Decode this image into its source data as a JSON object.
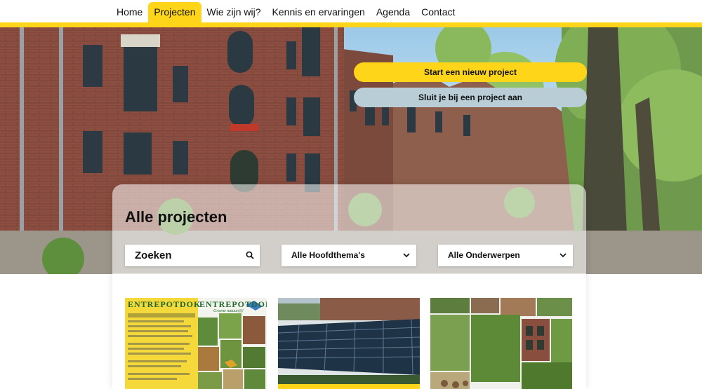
{
  "nav": {
    "items": [
      {
        "label": "Home"
      },
      {
        "label": "Projecten",
        "active": true
      },
      {
        "label": "Wie zijn wij?"
      },
      {
        "label": "Kennis en ervaringen"
      },
      {
        "label": "Agenda"
      },
      {
        "label": "Contact"
      }
    ]
  },
  "hero": {
    "start_project_label": "Start een nieuw project",
    "join_project_label": "Sluit je bij een project aan"
  },
  "projects": {
    "title": "Alle projecten",
    "search": {
      "placeholder": "Zoeken",
      "icon": "search-icon"
    },
    "filter_themes": {
      "value": "Alle Hoofdthema's",
      "icon": "chevron-down-icon"
    },
    "filter_topics": {
      "value": "Alle Onderwerpen",
      "icon": "chevron-down-icon"
    },
    "cards": [
      {
        "image": "entrepotdok-poster",
        "heading": "ENTREPOTDOK",
        "subheading": "Groene natuur(t)!"
      },
      {
        "image": "solar-panels-roof"
      },
      {
        "image": "green-collage"
      }
    ]
  },
  "colors": {
    "accent": "#ffd51a",
    "secondary": "#b9cdd6"
  }
}
